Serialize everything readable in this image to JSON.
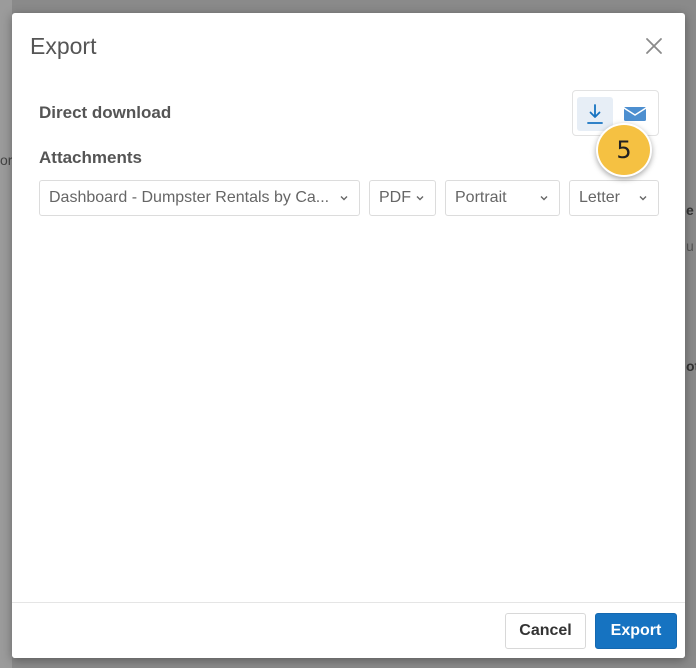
{
  "dialog": {
    "title": "Export",
    "direct_download_label": "Direct download",
    "attachments_label": "Attachments",
    "step_badge": "5"
  },
  "attachment": {
    "dashboard_value": "Dashboard - Dumpster Rentals by Ca...",
    "format_value": "PDF",
    "orientation_value": "Portrait",
    "paper_size_value": "Letter"
  },
  "footer": {
    "cancel_label": "Cancel",
    "export_label": "Export"
  },
  "background": {
    "fragment_1": "or",
    "fragment_2": "e",
    "fragment_3": "u",
    "fragment_4": "ot"
  },
  "colors": {
    "primary": "#1673c1",
    "badge": "#f5c142",
    "active_toggle": "#e7eef6"
  },
  "icons": {
    "close": "close-icon",
    "download": "download-icon",
    "email": "envelope-icon",
    "chevron": "chevron-down-icon"
  }
}
